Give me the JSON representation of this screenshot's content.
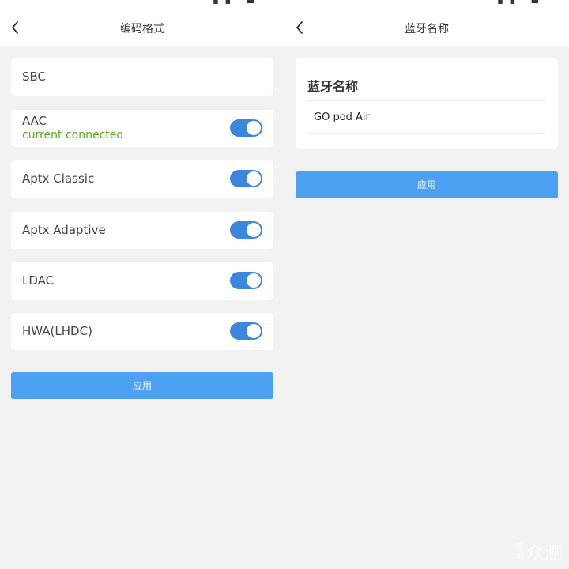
{
  "left": {
    "nav_title": "编码格式",
    "codecs": [
      {
        "label": "SBC",
        "sub": "",
        "toggle": false
      },
      {
        "label": "AAC",
        "sub": "current connected",
        "toggle": true,
        "enabled": true
      },
      {
        "label": "Aptx Classic",
        "sub": "",
        "toggle": true,
        "enabled": true
      },
      {
        "label": "Aptx Adaptive",
        "sub": "",
        "toggle": true,
        "enabled": true
      },
      {
        "label": "LDAC",
        "sub": "",
        "toggle": true,
        "enabled": true
      },
      {
        "label": "HWA(LHDC)",
        "sub": "",
        "toggle": true,
        "enabled": true
      }
    ],
    "apply_label": "应用"
  },
  "right": {
    "nav_title": "蓝牙名称",
    "card_title": "蓝牙名称",
    "name_value": "GO pod Air",
    "apply_label": "应用"
  },
  "watermark": {
    "small": "新浪",
    "large": "众测"
  },
  "colors": {
    "background": "#f2f2f2",
    "card": "#ffffff",
    "toggle_on": "#3d86dd",
    "apply_button": "#4da1f3",
    "connected_text": "#59a922"
  },
  "icons": {
    "back": "chevron-left-icon"
  }
}
